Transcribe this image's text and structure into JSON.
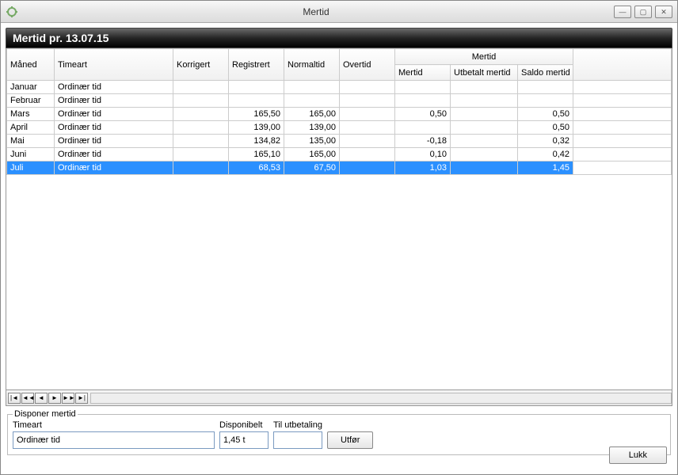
{
  "window": {
    "title": "Mertid",
    "banner": "Mertid pr. 13.07.15"
  },
  "headers": {
    "maned": "Måned",
    "timeart": "Timeart",
    "korrigert": "Korrigert",
    "registrert": "Registrert",
    "normaltid": "Normaltid",
    "overtid": "Overtid",
    "mertid_group": "Mertid",
    "mertid": "Mertid",
    "utbetalt_mertid": "Utbetalt mertid",
    "saldo_mertid": "Saldo mertid"
  },
  "rows": [
    {
      "maned": "Januar",
      "timeart": "Ordinær tid",
      "korrigert": "",
      "registrert": "",
      "normaltid": "",
      "overtid": "",
      "mertid": "",
      "utbetalt": "",
      "saldo": ""
    },
    {
      "maned": "Februar",
      "timeart": "Ordinær tid",
      "korrigert": "",
      "registrert": "",
      "normaltid": "",
      "overtid": "",
      "mertid": "",
      "utbetalt": "",
      "saldo": ""
    },
    {
      "maned": "Mars",
      "timeart": "Ordinær tid",
      "korrigert": "",
      "registrert": "165,50",
      "normaltid": "165,00",
      "overtid": "",
      "mertid": "0,50",
      "utbetalt": "",
      "saldo": "0,50"
    },
    {
      "maned": "April",
      "timeart": "Ordinær tid",
      "korrigert": "",
      "registrert": "139,00",
      "normaltid": "139,00",
      "overtid": "",
      "mertid": "",
      "utbetalt": "",
      "saldo": "0,50"
    },
    {
      "maned": "Mai",
      "timeart": "Ordinær tid",
      "korrigert": "",
      "registrert": "134,82",
      "normaltid": "135,00",
      "overtid": "",
      "mertid": "-0,18",
      "utbetalt": "",
      "saldo": "0,32"
    },
    {
      "maned": "Juni",
      "timeart": "Ordinær tid",
      "korrigert": "",
      "registrert": "165,10",
      "normaltid": "165,00",
      "overtid": "",
      "mertid": "0,10",
      "utbetalt": "",
      "saldo": "0,42"
    },
    {
      "maned": "Juli",
      "timeart": "Ordinær tid",
      "korrigert": "",
      "registrert": "68,53",
      "normaltid": "67,50",
      "overtid": "",
      "mertid": "1,03",
      "utbetalt": "",
      "saldo": "1,45",
      "selected": true
    }
  ],
  "disponer": {
    "legend": "Disponer mertid",
    "timeart_label": "Timeart",
    "disponibelt_label": "Disponibelt",
    "tilutbetaling_label": "Til utbetaling",
    "timeart_value": "Ordinær tid",
    "disponibelt_value": "1,45 t",
    "tilutbetaling_value": "",
    "utfor_label": "Utfør"
  },
  "buttons": {
    "lukk": "Lukk"
  }
}
